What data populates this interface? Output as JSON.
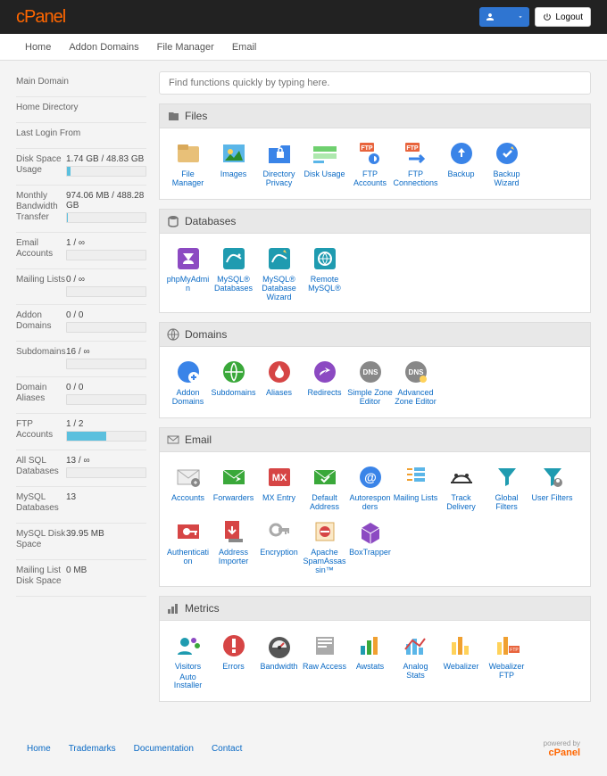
{
  "top": {
    "logo_a": "cPanel",
    "logout": "Logout"
  },
  "nav": [
    "Home",
    "Addon Domains",
    "File Manager",
    "Email"
  ],
  "search_placeholder": "Find functions quickly by typing here.",
  "stats_plain": [
    {
      "label": "Main Domain",
      "value": ""
    },
    {
      "label": "Home Directory",
      "value": ""
    },
    {
      "label": "Last Login From",
      "value": ""
    }
  ],
  "stats_bar": [
    {
      "label": "Disk Space Usage",
      "value": "1.74 GB / 48.83 GB",
      "pct": 4
    },
    {
      "label": "Monthly Bandwidth Transfer",
      "value": "974.06 MB / 488.28 GB",
      "pct": 1
    },
    {
      "label": "Email Accounts",
      "value": "1 / ∞",
      "pct": 0
    },
    {
      "label": "Mailing Lists",
      "value": "0 / ∞",
      "pct": 0
    },
    {
      "label": "Addon Domains",
      "value": "0 / 0",
      "pct": 0
    },
    {
      "label": "Subdomains",
      "value": "16 / ∞",
      "pct": 0
    },
    {
      "label": "Domain Aliases",
      "value": "0 / 0",
      "pct": 0
    },
    {
      "label": "FTP Accounts",
      "value": "1 / 2",
      "pct": 50
    },
    {
      "label": "All SQL Databases",
      "value": "13 / ∞",
      "pct": 0
    }
  ],
  "stats_simple": [
    {
      "label": "MySQL Databases",
      "value": "13"
    },
    {
      "label": "MySQL Disk Space",
      "value": "39.95 MB"
    },
    {
      "label": "Mailing List Disk Space",
      "value": "0 MB"
    }
  ],
  "panels": [
    {
      "title": "Files",
      "icon": "files",
      "apps": [
        {
          "label": "File Manager",
          "icon": "filemanager"
        },
        {
          "label": "Images",
          "icon": "images"
        },
        {
          "label": "Directory Privacy",
          "icon": "dirprivacy"
        },
        {
          "label": "Disk Usage",
          "icon": "diskusage"
        },
        {
          "label": "FTP Accounts",
          "icon": "ftpacct"
        },
        {
          "label": "FTP Connections",
          "icon": "ftpconn"
        },
        {
          "label": "Backup",
          "icon": "backup"
        },
        {
          "label": "Backup Wizard",
          "icon": "backupwiz"
        }
      ]
    },
    {
      "title": "Databases",
      "icon": "db",
      "apps": [
        {
          "label": "phpMyAdmin",
          "icon": "pma"
        },
        {
          "label": "MySQL® Databases",
          "icon": "mysql"
        },
        {
          "label": "MySQL® Database Wizard",
          "icon": "mysqlwiz"
        },
        {
          "label": "Remote MySQL®",
          "icon": "remote"
        }
      ]
    },
    {
      "title": "Domains",
      "icon": "globe",
      "apps": [
        {
          "label": "Addon Domains",
          "icon": "addon"
        },
        {
          "label": "Subdomains",
          "icon": "subdom"
        },
        {
          "label": "Aliases",
          "icon": "alias"
        },
        {
          "label": "Redirects",
          "icon": "redirect"
        },
        {
          "label": "Simple Zone Editor",
          "icon": "szone"
        },
        {
          "label": "Advanced Zone Editor",
          "icon": "azone"
        }
      ]
    },
    {
      "title": "Email",
      "icon": "email",
      "apps": [
        {
          "label": "Accounts",
          "icon": "emailacct"
        },
        {
          "label": "Forwarders",
          "icon": "forwarders"
        },
        {
          "label": "MX Entry",
          "icon": "mxentry"
        },
        {
          "label": "Default Address",
          "icon": "defaddr"
        },
        {
          "label": "Autoresponders",
          "icon": "autoresp"
        },
        {
          "label": "Mailing Lists",
          "icon": "mlists"
        },
        {
          "label": "Track Delivery",
          "icon": "trackdel"
        },
        {
          "label": "Global Filters",
          "icon": "gfilter"
        },
        {
          "label": "User Filters",
          "icon": "ufilter"
        },
        {
          "label": "Authentication",
          "icon": "auth"
        },
        {
          "label": "Address Importer",
          "icon": "addrimp"
        },
        {
          "label": "Encryption",
          "icon": "encrypt"
        },
        {
          "label": "Apache SpamAssassin™",
          "icon": "spam"
        },
        {
          "label": "BoxTrapper",
          "icon": "boxtrap"
        }
      ]
    },
    {
      "title": "Metrics",
      "icon": "metrics",
      "apps": [
        {
          "label": "Visitors",
          "icon": "visitors"
        },
        {
          "label": "Errors",
          "icon": "errors"
        },
        {
          "label": "Bandwidth",
          "icon": "bandwidth"
        },
        {
          "label": "Raw Access",
          "icon": "rawaccess"
        },
        {
          "label": "Awstats",
          "icon": "awstats"
        },
        {
          "label": "Analog Stats",
          "icon": "analog"
        },
        {
          "label": "Webalizer",
          "icon": "webalizer"
        },
        {
          "label": "Webalizer FTP",
          "icon": "webalizerftp"
        }
      ]
    }
  ],
  "extra_apps": [
    {
      "label": "Auto Installer"
    }
  ],
  "footer_links": [
    "Home",
    "Trademarks",
    "Documentation",
    "Contact"
  ],
  "powered": {
    "line1": "powered by",
    "line2": "cPanel"
  }
}
